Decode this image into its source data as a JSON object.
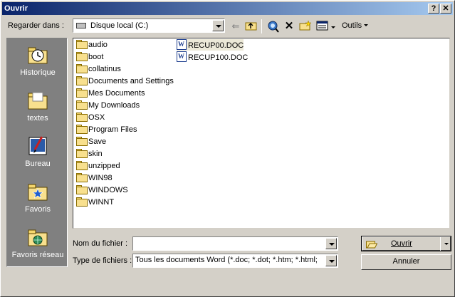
{
  "window": {
    "title": "Ouvrir",
    "help_label": "?",
    "close_label": "✕"
  },
  "toolbar": {
    "look_in_label": "Regarder dans :",
    "look_in_value": "Disque local (C:)",
    "tools_label": "Outils"
  },
  "places": [
    {
      "label": "Historique",
      "icon": "history-icon"
    },
    {
      "label": "textes",
      "icon": "folder-icon"
    },
    {
      "label": "Bureau",
      "icon": "desktop-icon"
    },
    {
      "label": "Favoris",
      "icon": "favorites-icon"
    },
    {
      "label": "Favoris réseau",
      "icon": "network-favorites-icon"
    }
  ],
  "folders": [
    "audio",
    "boot",
    "collatinus",
    "Documents and Settings",
    "Mes Documents",
    "My Downloads",
    "OSX",
    "Program Files",
    "Save",
    "skin",
    "unzipped",
    "WIN98",
    "WINDOWS",
    "WINNT"
  ],
  "files": [
    "RECUP00.DOC",
    "RECUP100.DOC"
  ],
  "footer": {
    "filename_label": "Nom du fichier :",
    "filename_value": "",
    "filetype_label": "Type de fichiers :",
    "filetype_value": "Tous les documents Word (*.doc; *.dot; *.htm; *.html;",
    "open_label": "Ouvrir",
    "cancel_label": "Annuler"
  }
}
